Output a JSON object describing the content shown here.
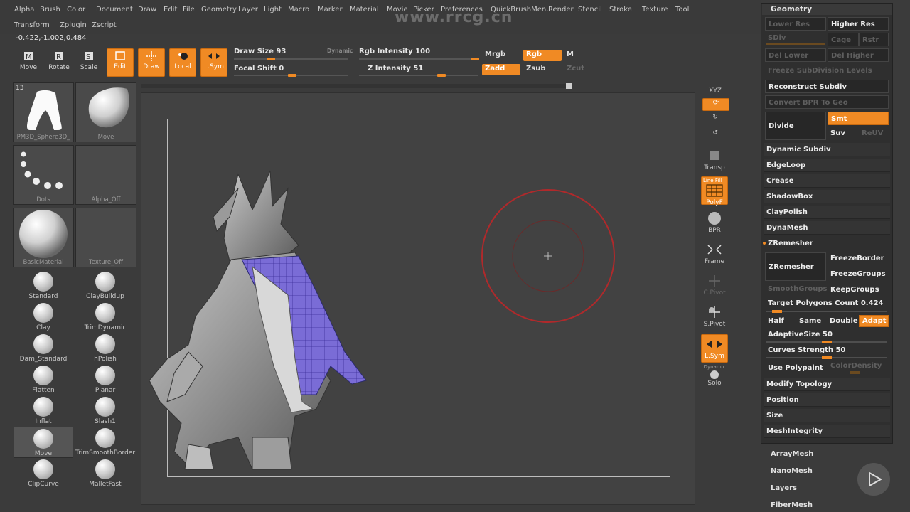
{
  "menu": [
    "Alpha",
    "Brush",
    "Color",
    "Document",
    "Draw",
    "Edit",
    "File",
    "Geometry",
    "Layer",
    "Light",
    "Macro",
    "Marker",
    "Material",
    "Movie",
    "Picker",
    "Preferences",
    "QuickBrushMenu",
    "Render",
    "Stencil",
    "Stroke",
    "Texture",
    "Tool"
  ],
  "menu2": [
    "Transform",
    "Zplugin",
    "Zscript"
  ],
  "coords": "-0.422,-1.002,0.484",
  "watermark_top": "www.rrcg.cn",
  "tools": {
    "move": "Move",
    "rotate": "Rotate",
    "scale": "Scale",
    "edit": "Edit",
    "draw": "Draw",
    "local": "Local",
    "lsym": "L.Sym"
  },
  "sliders": {
    "draw_size_label": "Draw Size 93",
    "dynamic_label": "Dynamic",
    "rgb_intensity_label": "Rgb  Intensity 100",
    "focal_shift_label": "Focal  Shift 0",
    "z_intensity_label": "Z  Intensity 51",
    "mrgb": "Mrgb",
    "rgb": "Rgb",
    "m": "M",
    "zadd": "Zadd",
    "zsub": "Zsub",
    "zcut": "Zcut"
  },
  "shelf": {
    "tool_count": "13",
    "tool_name": "PM3D_Sphere3D_",
    "move_thumb": "Move",
    "dots": "Dots",
    "alpha": "Alpha_Off",
    "material": "BasicMaterial",
    "texture": "Texture_Off"
  },
  "brushes": [
    [
      "Standard",
      "ClayBuildup"
    ],
    [
      "Clay",
      "TrimDynamic"
    ],
    [
      "Dam_Standard",
      "hPolish"
    ],
    [
      "Flatten",
      "Planar"
    ],
    [
      "Inflat",
      "Slash1"
    ],
    [
      "Move",
      "TrimSmoothBorder"
    ],
    [
      "ClipCurve",
      "MalletFast"
    ]
  ],
  "right_toolbar": {
    "xyz": "XYZ",
    "transp": "Transp",
    "line_fill": "Line Fill",
    "polyf": "PolyF",
    "bpr": "BPR",
    "frame": "Frame",
    "cpivot": "C.Pivot",
    "spivot": "S.Pivot",
    "lsym": "L.Sym",
    "dynamic": "Dynamic",
    "solo": "Solo"
  },
  "geometry": {
    "title": "Geometry",
    "lower_res": "Lower Res",
    "higher_res": "Higher Res",
    "sdiv": "SDiv",
    "cage": "Cage",
    "rstr": "Rstr",
    "del_lower": "Del Lower",
    "del_higher": "Del Higher",
    "freeze_subdiv": "Freeze SubDivision Levels",
    "reconstruct": "Reconstruct Subdiv",
    "convert_bpr": "Convert BPR To Geo",
    "divide": "Divide",
    "smt": "Smt",
    "suv": "Suv",
    "reuv": "ReUV",
    "dynamic_subdiv": "Dynamic Subdiv",
    "edgeloop": "EdgeLoop",
    "crease": "Crease",
    "shadowbox": "ShadowBox",
    "claypolish": "ClayPolish",
    "dynamesh": "DynaMesh",
    "zremesher_header": "ZRemesher",
    "zremesher_btn": "ZRemesher",
    "freeze_border": "FreezeBorder",
    "freeze_groups": "FreezeGroups",
    "smooth_groups": "SmoothGroups",
    "keep_groups": "KeepGroups",
    "target_polys": "Target Polygons Count 0.424",
    "target_polys_value": 0.05,
    "half": "Half",
    "same": "Same",
    "double": "Double",
    "adapt": "Adapt",
    "adaptive_size": "AdaptiveSize 50",
    "curves_strength": "Curves Strength 50",
    "use_polypaint": "Use Polypaint",
    "color_density": "ColorDensity",
    "modify_topology": "Modify Topology",
    "position": "Position",
    "size": "Size",
    "mesh_integrity": "MeshIntegrity"
  },
  "subpalettes": [
    "ArrayMesh",
    "NanoMesh",
    "Layers",
    "FiberMesh"
  ],
  "colors": {
    "accent": "#f08a24",
    "panel": "#2f2f2f",
    "canvas": "#424242"
  }
}
